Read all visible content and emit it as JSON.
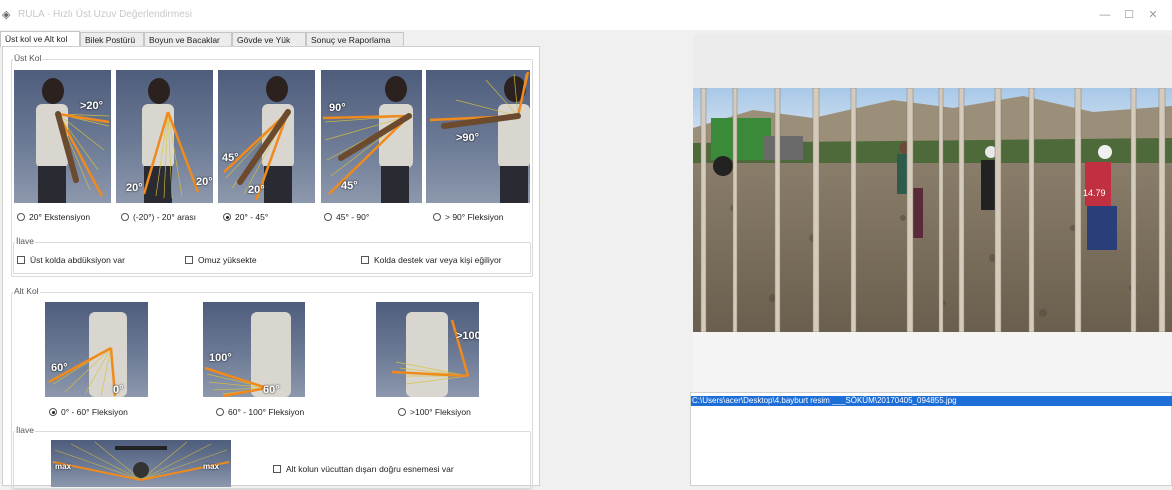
{
  "window": {
    "title": "RULA - Hızlı Üst Uzuv Değerlendirmesi",
    "controls": {
      "minimize": "—",
      "maximize": "☐",
      "close": "✕"
    }
  },
  "tabs": [
    {
      "label": "Üst kol ve Alt kol",
      "active": true
    },
    {
      "label": "Bilek Postürü"
    },
    {
      "label": "Boyun ve Bacaklar"
    },
    {
      "label": "Gövde ve Yük"
    },
    {
      "label": "Sonuç ve Raporlama"
    }
  ],
  "upper_arm": {
    "group_label": "Üst Kol",
    "angle_labels": [
      [
        ">20°"
      ],
      [
        "20°",
        "20°"
      ],
      [
        "45°",
        "20°"
      ],
      [
        "90°",
        "45°"
      ],
      [
        ">90°"
      ]
    ],
    "options": [
      {
        "label": "20° Ekstensiyon",
        "selected": false
      },
      {
        "label": "(-20°) - 20° arası",
        "selected": false
      },
      {
        "label": "20° - 45°",
        "selected": true
      },
      {
        "label": "45° - 90°",
        "selected": false
      },
      {
        "label": "> 90° Fleksiyon",
        "selected": false
      }
    ],
    "extra": {
      "label": "İlave",
      "checks": [
        {
          "label": "Üst kolda abdüksiyon var",
          "checked": false
        },
        {
          "label": "Omuz yüksekte",
          "checked": false
        },
        {
          "label": "Kolda destek var veya kişi eğiliyor",
          "checked": false
        }
      ]
    }
  },
  "lower_arm": {
    "group_label": "Alt Kol",
    "angle_labels": [
      [
        "60°",
        "0°"
      ],
      [
        "100°",
        "60°"
      ],
      [
        ">100°"
      ]
    ],
    "options": [
      {
        "label": "0° - 60° Fleksiyon",
        "selected": true
      },
      {
        "label": "60° - 100° Fleksiyon",
        "selected": false
      },
      {
        "label": ">100° Fleksiyon",
        "selected": false
      }
    ],
    "extra": {
      "label": "İlave",
      "thumb_labels": [
        "max",
        "max"
      ],
      "checks": [
        {
          "label": "Alt kolun vücuttan dışarı doğru esnemesi var",
          "checked": false
        }
      ]
    }
  },
  "preview": {
    "photo_overlay": "14.79",
    "file_path": "C:\\Users\\acer\\Desktop\\4.bayburt resim ___SÖKÜM\\20170405_094855.jpg"
  },
  "colors": {
    "accent": "#1e6ed8",
    "angle_line": "#f08a1c",
    "fan_line": "#d9c23a"
  }
}
